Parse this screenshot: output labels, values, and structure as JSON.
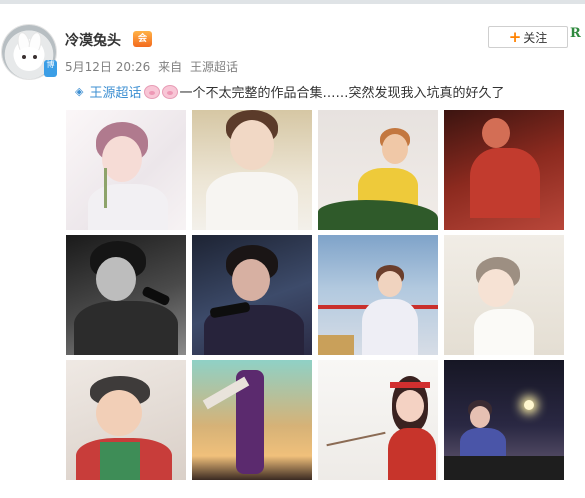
{
  "post": {
    "username": "冷漠兔头",
    "vip_badge": "会",
    "verified_badge": "博",
    "date": "5月12日 20:26",
    "source_prefix": "来自",
    "source": "王源超话",
    "follow_label": "关注",
    "side_logo": "R",
    "topic_icon": "supertopic-icon",
    "topic": "王源超话",
    "text": "一个不太完整的作品合集……突然发现我入坑真的好久了"
  },
  "images": [
    {
      "name": "artwork-1",
      "desc": "boy with pink hair holding flower"
    },
    {
      "name": "artwork-2",
      "desc": "boy in white shirt warm light"
    },
    {
      "name": "artwork-3",
      "desc": "boy in yellow shirt with green plant"
    },
    {
      "name": "artwork-4",
      "desc": "figure in red tone"
    },
    {
      "name": "artwork-5",
      "desc": "singer with microphone monochrome"
    },
    {
      "name": "artwork-6",
      "desc": "singer with microphone blue purple"
    },
    {
      "name": "artwork-7",
      "desc": "boy on stage with blue sky"
    },
    {
      "name": "artwork-8",
      "desc": "boy with grey hair looking up"
    },
    {
      "name": "artwork-9",
      "desc": "boy with cap and red jacket"
    },
    {
      "name": "artwork-10",
      "desc": "dancer silhouette at sunset"
    },
    {
      "name": "artwork-11",
      "desc": "girl with red headband and blossoms"
    },
    {
      "name": "artwork-12",
      "desc": "figure with sparkler at night"
    }
  ],
  "colors": {
    "accent_orange": "#ff8200",
    "link_blue": "#3d8fd2",
    "text_main": "#333333",
    "text_meta": "#808080"
  }
}
